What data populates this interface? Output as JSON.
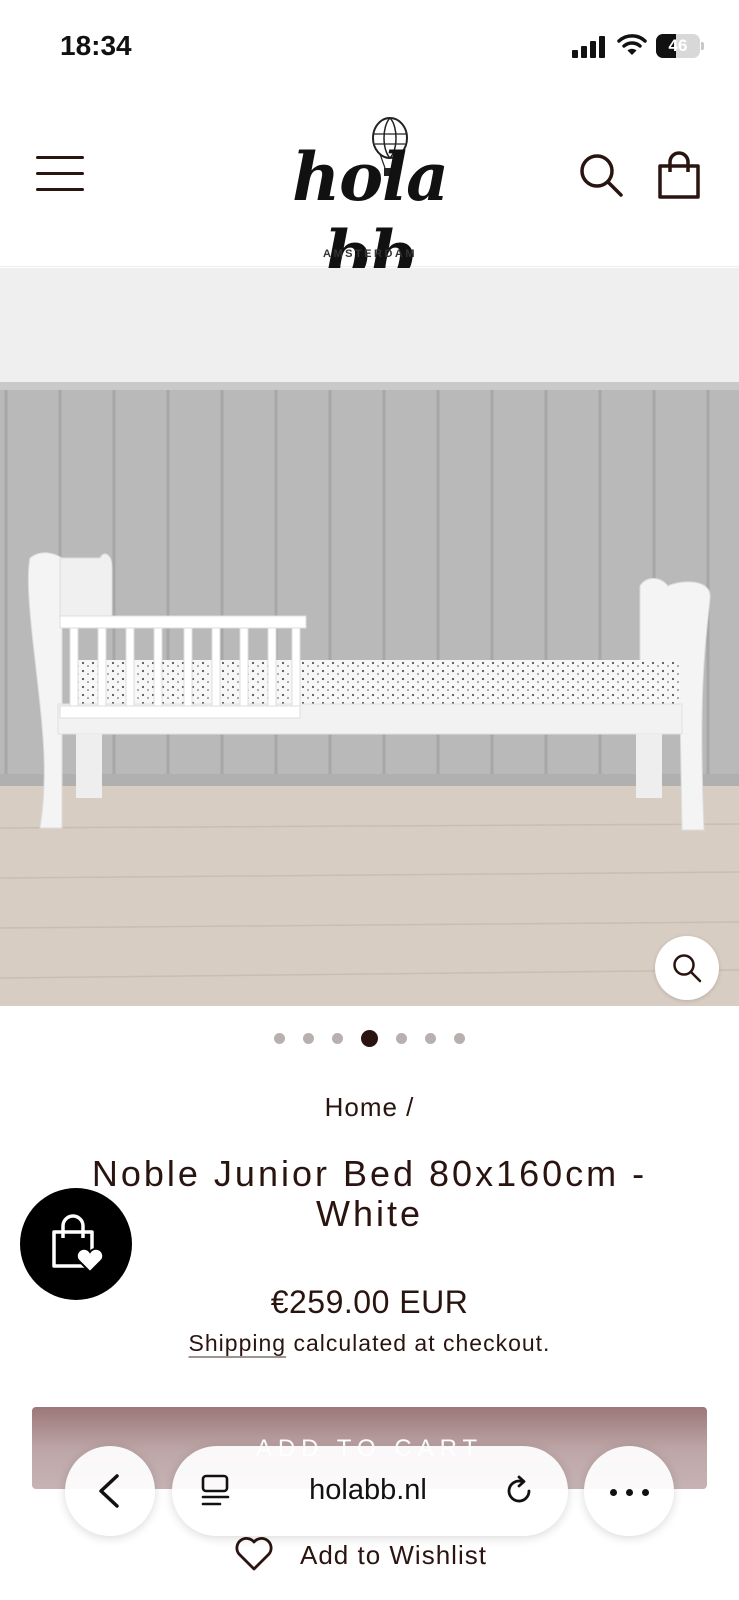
{
  "status_bar": {
    "time": "18:34",
    "battery_level": "46",
    "battery_fraction": 0.46
  },
  "header": {
    "logo_text": "hola bb",
    "logo_subtitle": "AMSTERDAM",
    "menu_icon": "hamburger-menu-icon",
    "search_icon": "search-icon",
    "cart_icon": "shopping-bag-icon"
  },
  "gallery": {
    "image_description_icon": "product-photo",
    "dot_count": 7,
    "active_dot": 4,
    "zoom_icon": "magnifier-icon"
  },
  "breadcrumb": {
    "home": "Home",
    "separator": " /"
  },
  "product": {
    "title": "Noble Junior Bed 80x160cm - White",
    "price": "€259.00 EUR",
    "shipping_link": "Shipping",
    "shipping_rest": " calculated at checkout.",
    "add_to_cart_label": "ADD TO CART",
    "wishlist_label": "Add to Wishlist"
  },
  "browser": {
    "url": "holabb.nl",
    "back_icon": "chevron-left-icon",
    "tabs_icon": "reader-tabs-icon",
    "reload_icon": "reload-icon",
    "more_icon": "ellipsis-icon"
  },
  "colors": {
    "brand_dark": "#2a1410",
    "cart_button": "#6e3a3c",
    "wishlist_fab": "#000000"
  }
}
